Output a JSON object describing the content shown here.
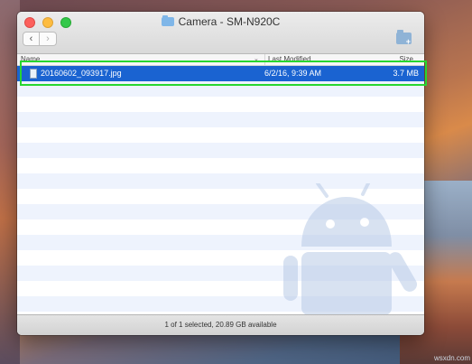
{
  "window": {
    "title": "Camera - SM-N920C"
  },
  "toolbar": {
    "back_icon": "chevron-left-icon",
    "forward_icon": "chevron-right-icon",
    "new_folder_icon": "new-folder-icon"
  },
  "columns": {
    "name": "Name",
    "modified": "Last Modified",
    "size": "Size",
    "sort_indicator": "⌄"
  },
  "files": [
    {
      "name": "20160602_093917.jpg",
      "modified": "6/2/16, 9:39 AM",
      "size": "3.7 MB",
      "selected": true
    }
  ],
  "status": {
    "text": "1 of 1 selected, 20.89 GB available"
  },
  "watermark": "wsxdn.com",
  "colors": {
    "selection": "#1a63d1",
    "highlight_box": "#27d630",
    "stripe": "#eef3fd",
    "watermark_android": "#b9cbe6"
  }
}
